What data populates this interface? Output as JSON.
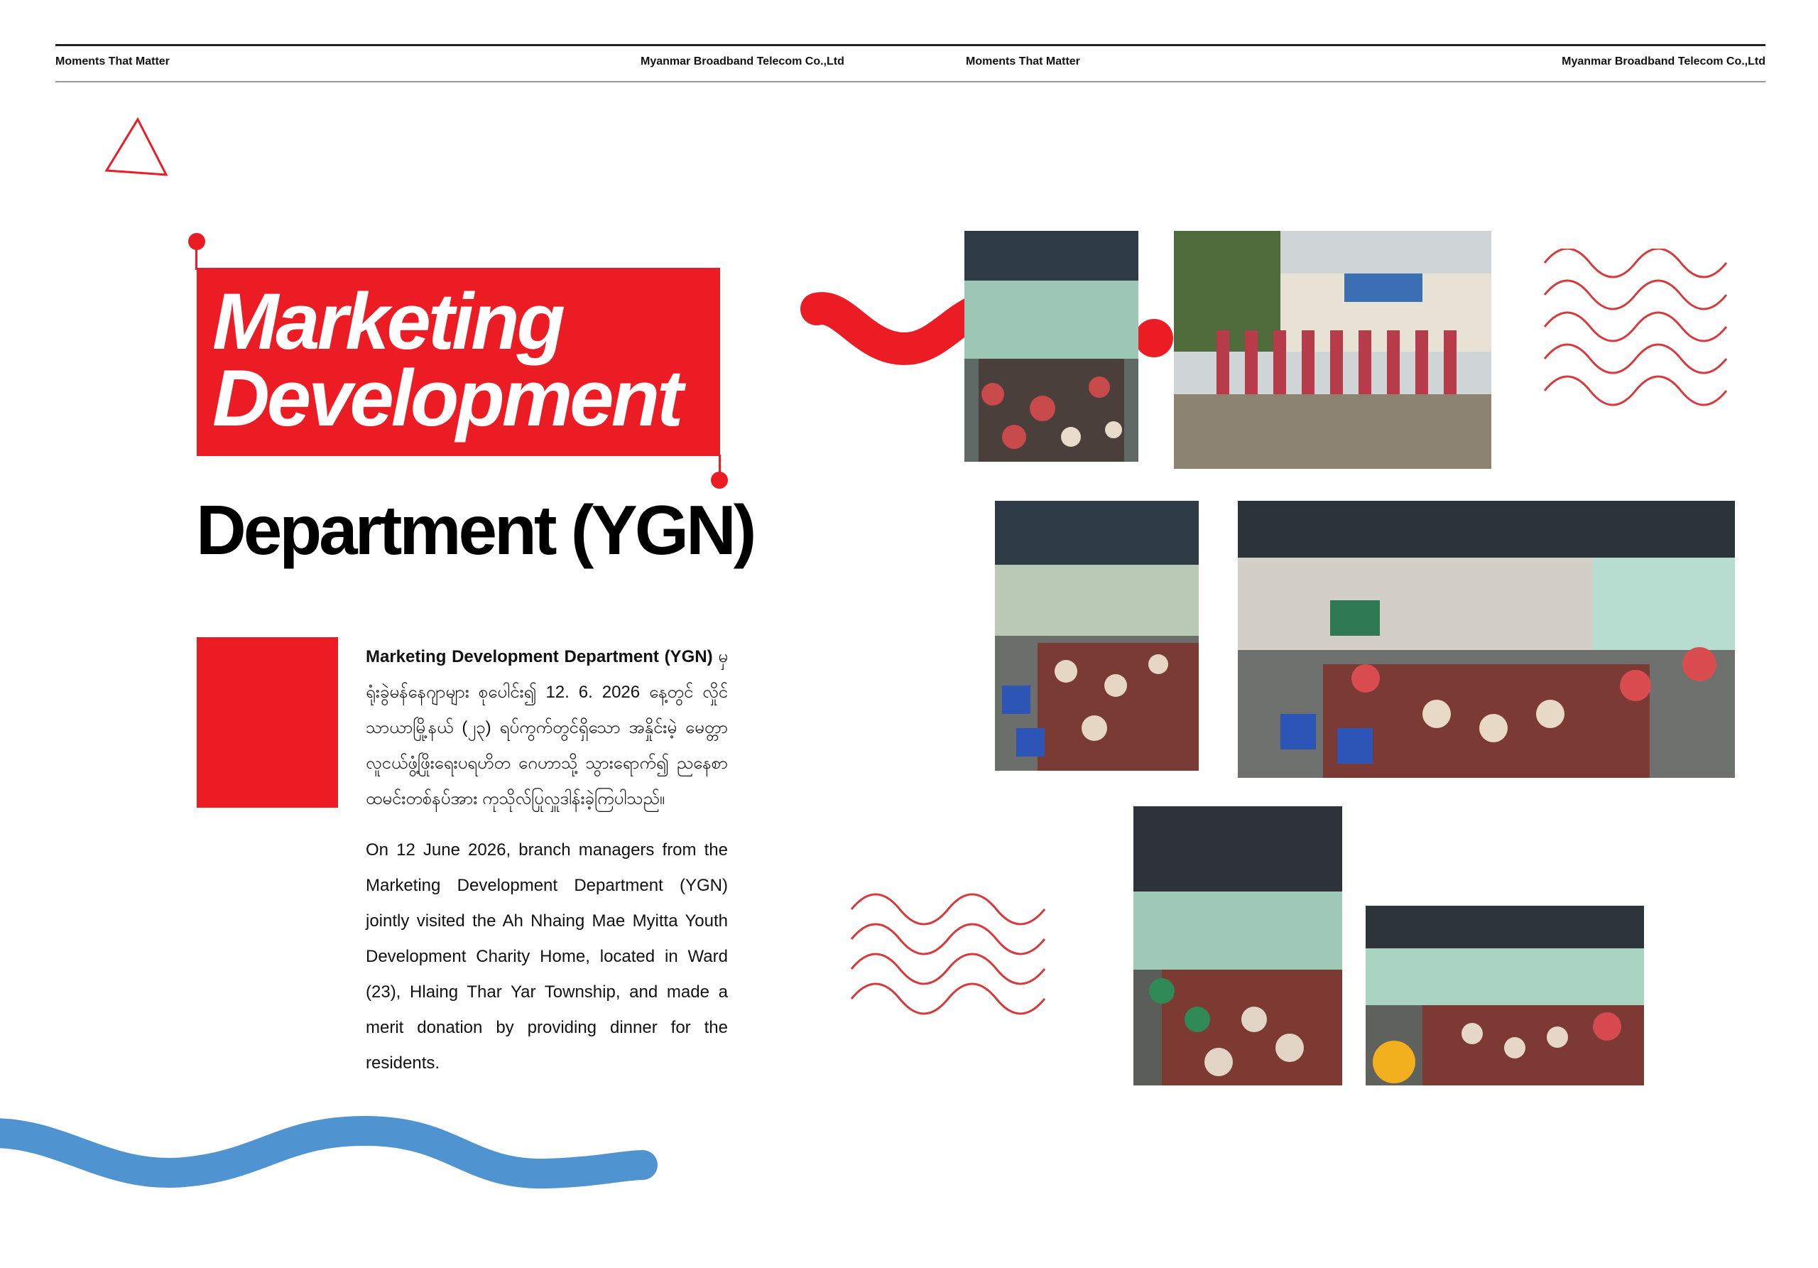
{
  "header": {
    "left_title": "Moments That Matter",
    "left_company": "Myanmar Broadband Telecom Co.,Ltd",
    "right_title": "Moments That Matter",
    "right_company": "Myanmar Broadband Telecom Co.,Ltd"
  },
  "title": {
    "line1": "Marketing",
    "line2": "Development",
    "line3": "Department (YGN)"
  },
  "body": {
    "myanmar_lead": "Marketing Development Department (YGN)",
    "myanmar_text": "မှ ရုံးခွဲမန်နေဂျာများ စုပေါင်း၍ 12. 6. 2026 နေ့တွင် လှိုင်သာယာမြို့နယ် (၂၃) ရပ်ကွက်တွင်ရှိသော အနှိုင်းမဲ့ မေတ္တာလူငယ်ဖွံ့ဖြိုးရေးပရဟိတ ဂေဟာသို့ သွားရောက်၍ ညနေစာ ထမင်းတစ်နပ်အား ကုသိုလ်ပြုလှူဒါန်းခဲ့ကြပါသည်။",
    "english_text": "On 12 June 2026, branch managers from the Marketing Development Department (YGN) jointly visited the Ah Nhaing Mae Myitta Youth Development Charity Home, located in Ward (23), Hlaing Thar Yar Township, and made a merit donation by providing dinner for the residents."
  },
  "colors": {
    "brand_red": "#ec1c24",
    "accent_blue": "#4f94d0",
    "text_dark": "#111111"
  },
  "photos": [
    {
      "name": "photo-dining-hall-small"
    },
    {
      "name": "photo-group-outdoor"
    },
    {
      "name": "photo-dining-tables-left"
    },
    {
      "name": "photo-dining-hall-wide"
    },
    {
      "name": "photo-dining-tall"
    },
    {
      "name": "photo-dining-bottom"
    }
  ]
}
